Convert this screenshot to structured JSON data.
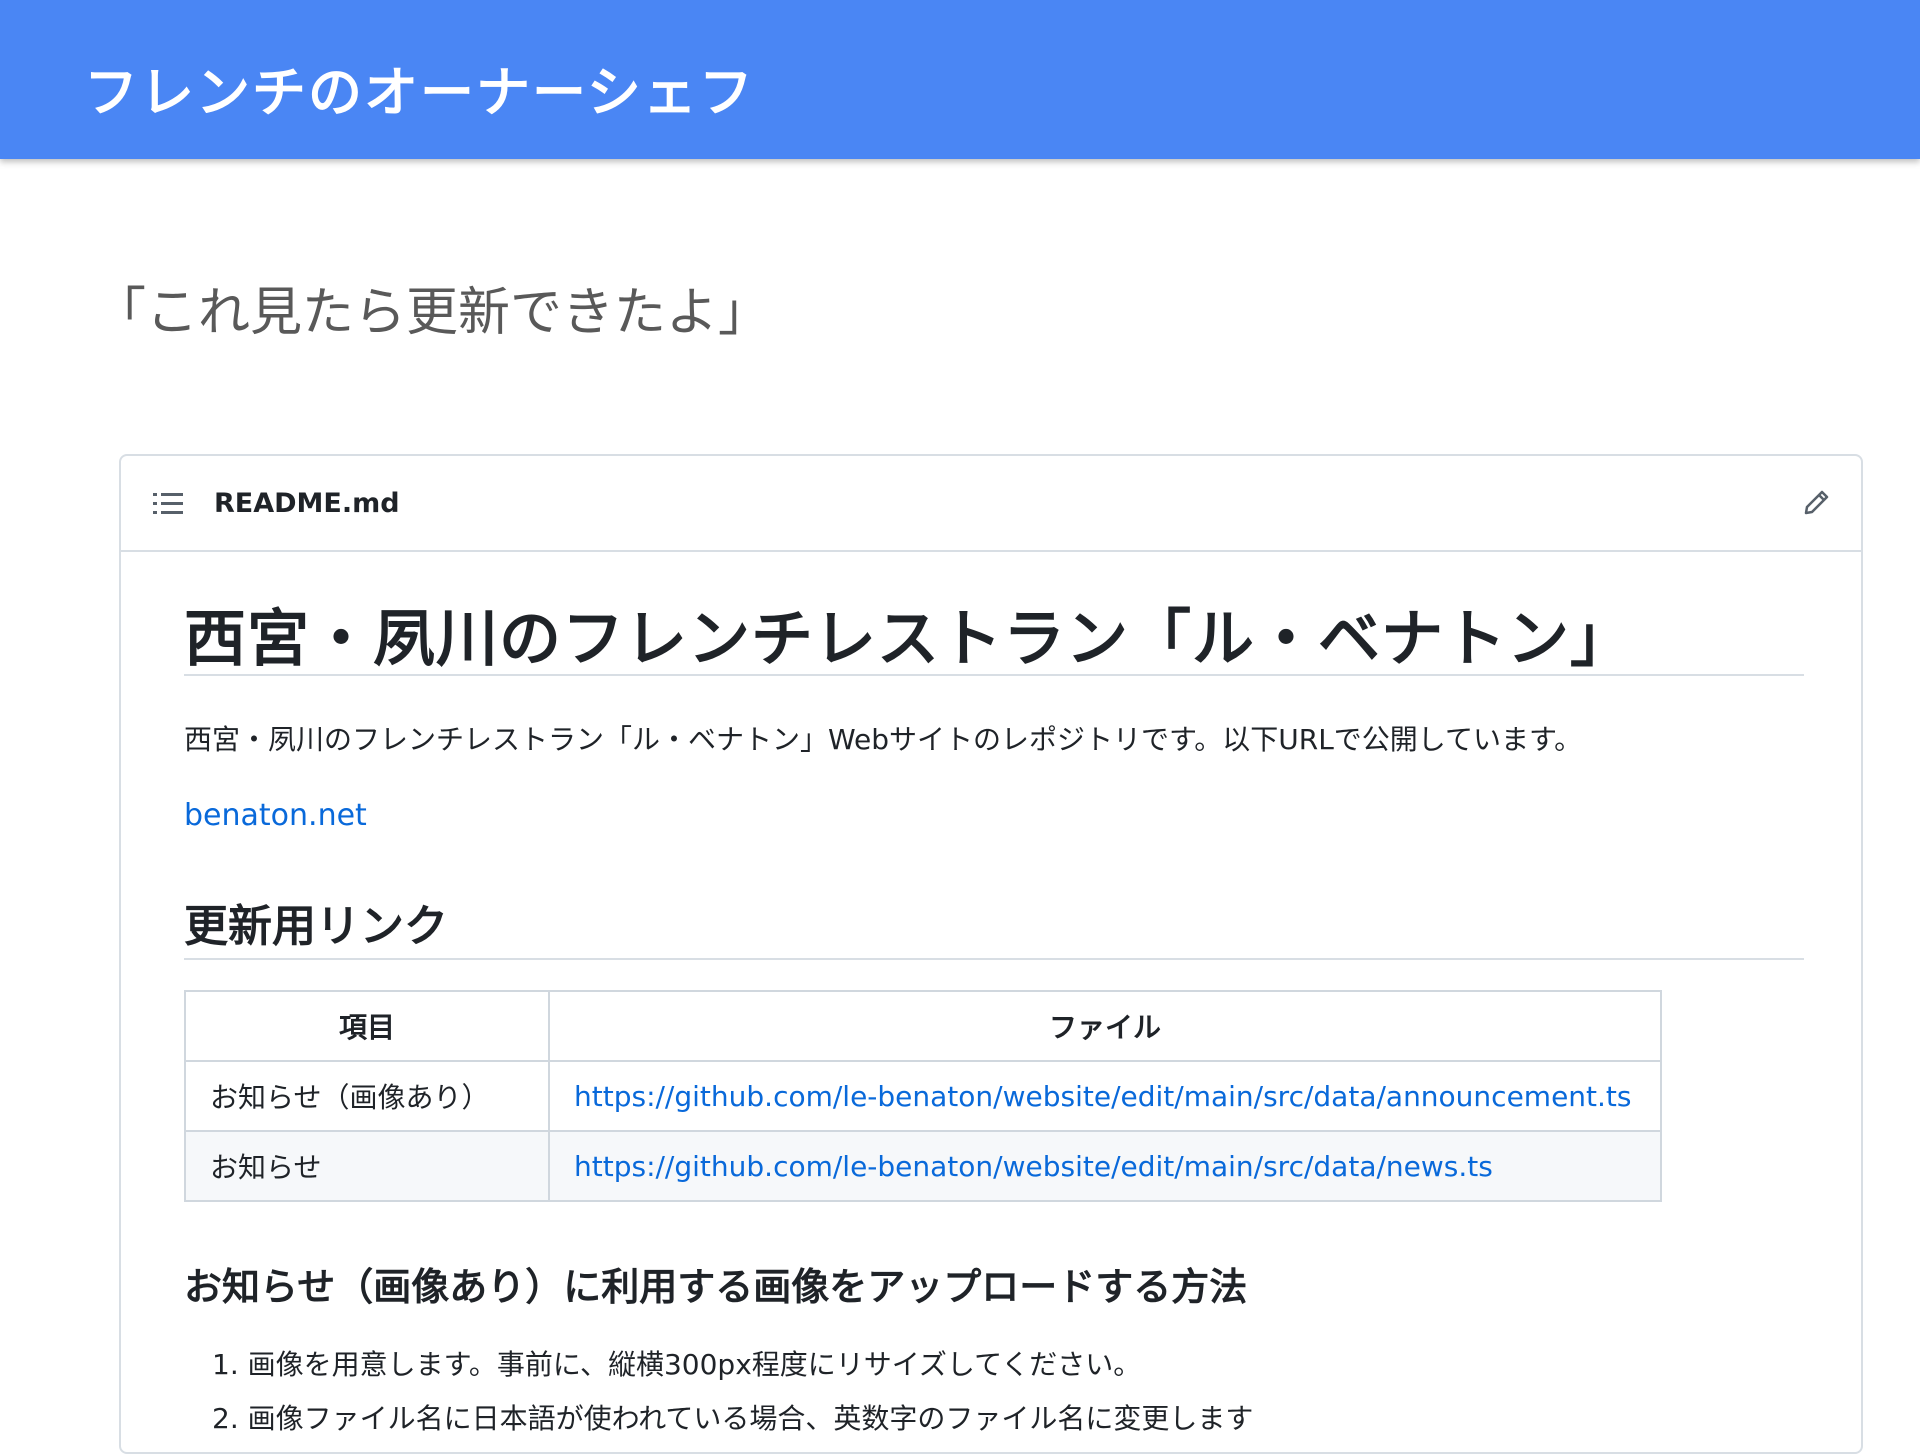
{
  "slide": {
    "title": "フレンチのオーナーシェフ",
    "quote": "「これ見たら更新できたよ」"
  },
  "readme": {
    "filename": "README.md",
    "icons": {
      "list": "list-icon",
      "edit": "pencil-icon"
    },
    "h1": "西宮・夙川のフレンチレストラン「ル・ベナトン」",
    "description": "西宮・夙川のフレンチレストラン「ル・ベナトン」Webサイトのレポジトリです。以下URLで公開しています。",
    "site_link": "benaton.net",
    "h2": "更新用リンク",
    "table": {
      "headers": [
        "項目",
        "ファイル"
      ],
      "rows": [
        [
          "お知らせ（画像あり）",
          "https://github.com/le-benaton/website/edit/main/src/data/announcement.ts"
        ],
        [
          "お知らせ",
          "https://github.com/le-benaton/website/edit/main/src/data/news.ts"
        ]
      ]
    },
    "h3": "お知らせ（画像あり）に利用する画像をアップロードする方法",
    "steps": [
      "1. 画像を用意します。事前に、縦横300px程度にリサイズしてください。",
      "2. 画像ファイル名に日本語が使われている場合、英数字のファイル名に変更します"
    ]
  },
  "colors": {
    "topbar": "#4a86f4",
    "link": "#0969da",
    "text": "#1f2328"
  }
}
